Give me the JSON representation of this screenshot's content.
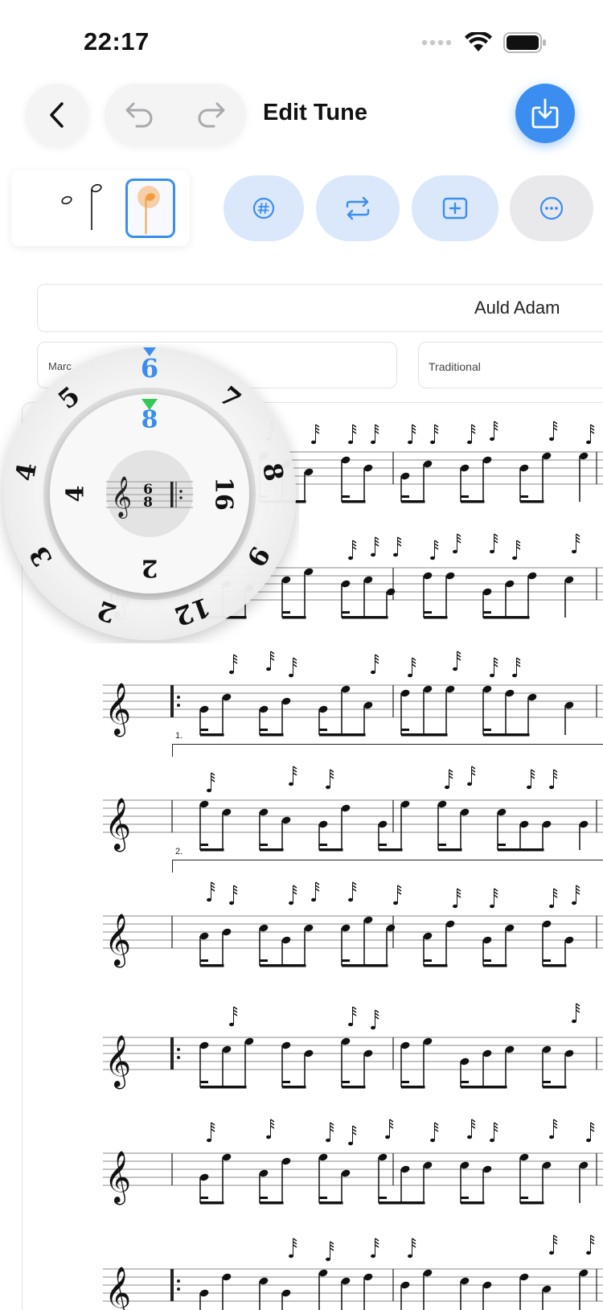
{
  "status_bar": {
    "time": "22:17"
  },
  "header": {
    "title": "Edit Tune"
  },
  "tune": {
    "title": "Auld Adam",
    "type_partial": "Marc",
    "composer": "Traditional"
  },
  "duration_picker": {
    "options": [
      "half",
      "half-stem",
      "quarter"
    ],
    "selected": "quarter"
  },
  "toolbar": {
    "icons": [
      "accidental-icon",
      "repeat-icon",
      "add-measure-icon",
      "more-icon"
    ]
  },
  "time_signature_wheel": {
    "outer_numbers": [
      "6",
      "7",
      "8",
      "9",
      "12",
      "2",
      "3",
      "4",
      "5"
    ],
    "outer_selected": "6",
    "inner_numbers": [
      "8",
      "16",
      "2",
      "4"
    ],
    "inner_selected": "8",
    "preview": {
      "top": "6",
      "bottom": "8"
    }
  },
  "score": {
    "volta_labels": [
      "1.",
      "2."
    ]
  },
  "colors": {
    "accent": "#3b8ef0",
    "selected_marker": "#34c759",
    "note_highlight": "#f39c3d"
  }
}
